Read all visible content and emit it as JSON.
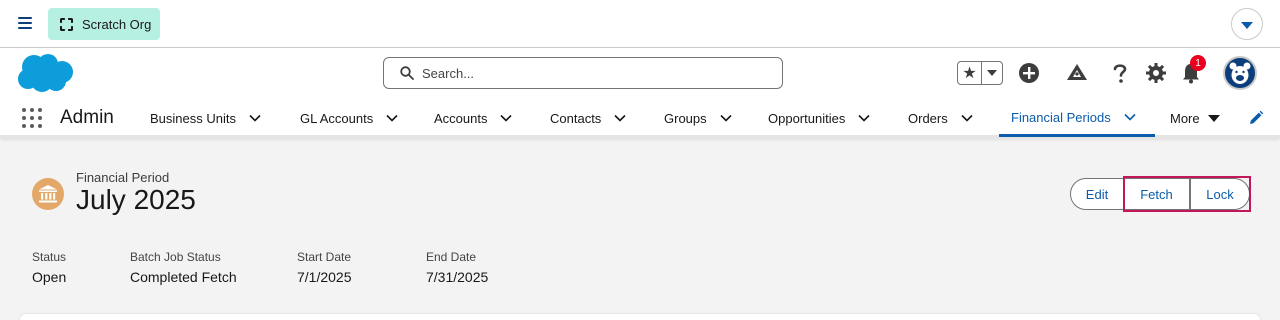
{
  "topbar": {
    "org_label": "Scratch Org"
  },
  "header": {
    "search_placeholder": "Search...",
    "notification_count": "1"
  },
  "nav": {
    "app_name": "Admin",
    "items": [
      {
        "label": "Business Units"
      },
      {
        "label": "GL Accounts"
      },
      {
        "label": "Accounts"
      },
      {
        "label": "Contacts"
      },
      {
        "label": "Groups"
      },
      {
        "label": "Opportunities"
      },
      {
        "label": "Orders"
      },
      {
        "label": "Financial Periods",
        "active": true
      }
    ],
    "more_label": "More"
  },
  "record": {
    "type_label": "Financial Period",
    "title": "July 2025",
    "actions": {
      "edit": "Edit",
      "fetch": "Fetch",
      "lock": "Lock"
    },
    "fields": [
      {
        "label": "Status",
        "value": "Open"
      },
      {
        "label": "Batch Job Status",
        "value": "Completed Fetch"
      },
      {
        "label": "Start Date",
        "value": "7/1/2025"
      },
      {
        "label": "End Date",
        "value": "7/31/2025"
      }
    ]
  },
  "colors": {
    "brand_blue": "#0b5cab",
    "org_badge": "#b6f0e2",
    "record_icon": "#e3a868",
    "highlight_border": "#c2185b",
    "notification": "#ea001e"
  }
}
